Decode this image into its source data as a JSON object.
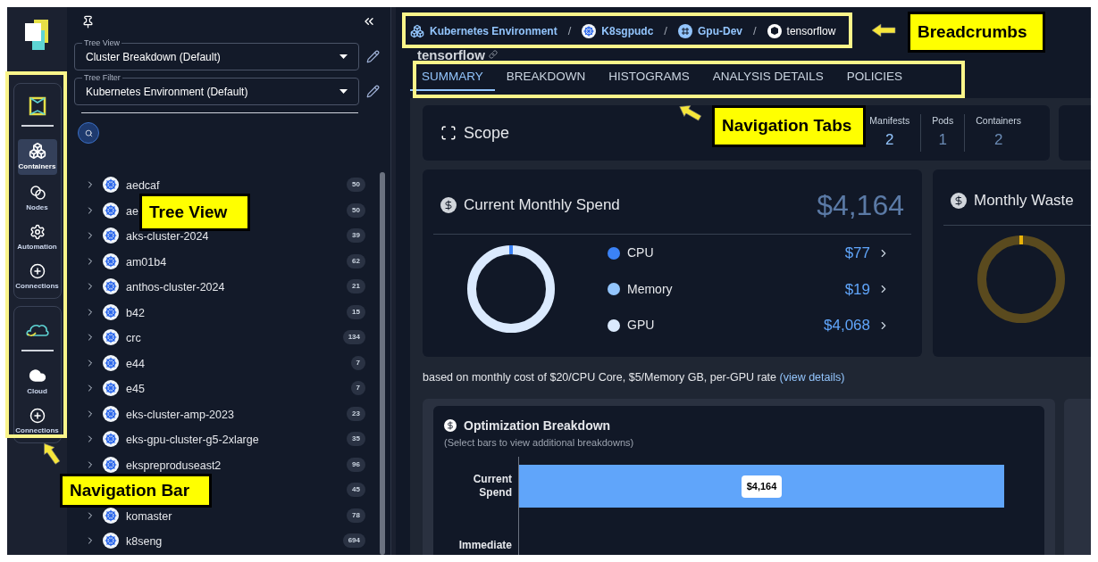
{
  "nav": {
    "groups": [
      {
        "items": [
          {
            "kind": "brand"
          },
          {
            "kind": "containers",
            "label": "Containers",
            "selected": true
          },
          {
            "kind": "nodes",
            "label": "Nodes",
            "selected": false
          },
          {
            "kind": "automation",
            "label": "Automation",
            "selected": false
          },
          {
            "kind": "connections",
            "label": "Connections",
            "selected": false
          }
        ]
      },
      {
        "items": [
          {
            "kind": "cloud-brand"
          },
          {
            "kind": "cloud",
            "label": "Cloud",
            "selected": false
          },
          {
            "kind": "connections",
            "label": "Connections",
            "selected": false
          }
        ]
      }
    ]
  },
  "tree_panel": {
    "selects": [
      {
        "label": "Tree View",
        "value": "Cluster Breakdown (Default)"
      },
      {
        "label": "Tree Filter",
        "value": "Kubernetes Environment (Default)"
      }
    ],
    "rows": [
      {
        "label": "aedcaf",
        "count": "50"
      },
      {
        "label": "ae",
        "count": "50"
      },
      {
        "label": "aks-cluster-2024",
        "count": "39"
      },
      {
        "label": "am01b4",
        "count": "62"
      },
      {
        "label": "anthos-cluster-2024",
        "count": "21"
      },
      {
        "label": "b42",
        "count": "15"
      },
      {
        "label": "crc",
        "count": "134"
      },
      {
        "label": "e44",
        "count": "7"
      },
      {
        "label": "e45",
        "count": "7"
      },
      {
        "label": "eks-cluster-amp-2023",
        "count": "23"
      },
      {
        "label": "eks-gpu-cluster-g5-2xlarge",
        "count": "35"
      },
      {
        "label": "ekspreproduseast2",
        "count": "96"
      },
      {
        "count": "45"
      },
      {
        "label": "komaster",
        "count": "78"
      },
      {
        "label": "k8seng",
        "count": "694"
      }
    ]
  },
  "breadcrumb_separator": "/",
  "breadcrumbs": [
    {
      "label": "Kubernetes Environment",
      "kind": "environment"
    },
    {
      "label": "K8sgpudc",
      "kind": "cluster"
    },
    {
      "label": "Gpu-Dev",
      "kind": "namespace"
    },
    {
      "label": "tensorflow",
      "kind": "workload"
    }
  ],
  "title": "tensorflow",
  "tabs": [
    {
      "label": "SUMMARY",
      "selected": true
    },
    {
      "label": "BREAKDOWN",
      "selected": false
    },
    {
      "label": "HISTOGRAMS",
      "selected": false
    },
    {
      "label": "ANALYSIS DETAILS",
      "selected": false
    },
    {
      "label": "POLICIES",
      "selected": false
    }
  ],
  "scope": {
    "title": "Scope",
    "stats": [
      {
        "label": "Manifests",
        "value": "2"
      },
      {
        "label": "Pods",
        "value": "1"
      },
      {
        "label": "Containers",
        "value": "2"
      }
    ]
  },
  "spend_card": {
    "title": "Current Monthly Spend",
    "total": "$4,164",
    "items": [
      {
        "label": "CPU",
        "value": "$77",
        "color": "#3b82f6"
      },
      {
        "label": "Memory",
        "value": "$19",
        "color": "#93c5fd"
      },
      {
        "label": "GPU",
        "value": "$4,068",
        "color": "#dbeafe"
      }
    ]
  },
  "waste_card": {
    "title": "Monthly Waste"
  },
  "footnote": "based on monthly cost of $20/CPU Core, $5/Memory GB, per-GPU rate",
  "footnote_link": "(view details)",
  "optimization": {
    "title": "Optimization Breakdown",
    "subtitle": "(Select bars to view additional breakdowns)",
    "bars": [
      {
        "label": "Current Spend",
        "value": "$4,164"
      },
      {
        "label": "Immediate"
      }
    ]
  },
  "annotations": [
    {
      "text": "Tree View",
      "kind": "tree"
    },
    {
      "text": "Navigation Bar",
      "kind": "nav"
    },
    {
      "text": "Breadcrumbs",
      "kind": "breadcrumbs"
    },
    {
      "text": "Navigation Tabs",
      "kind": "tabs"
    }
  ]
}
